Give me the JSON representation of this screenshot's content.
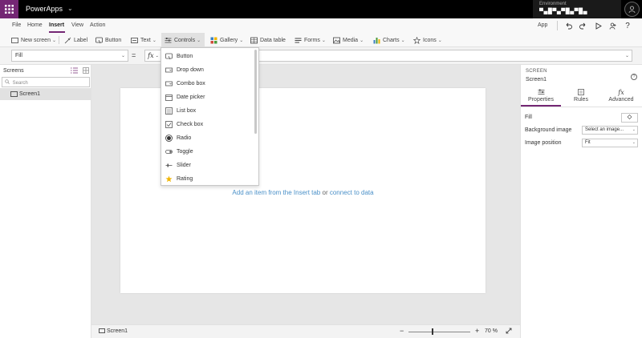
{
  "titlebar": {
    "app_name": "PowerApps",
    "environment_label": "Environment",
    "environment_value": "▀▄█▀▄▀█▄▀█▄"
  },
  "menu": {
    "items": [
      "File",
      "Home",
      "Insert",
      "View",
      "Action"
    ],
    "active": "Insert",
    "app_label": "App"
  },
  "ribbon": {
    "new_screen": "New screen",
    "label": "Label",
    "button": "Button",
    "text": "Text",
    "controls": "Controls",
    "gallery": "Gallery",
    "data_table": "Data table",
    "forms": "Forms",
    "media": "Media",
    "charts": "Charts",
    "icons": "Icons"
  },
  "formula": {
    "property": "Fill",
    "equals": "=",
    "fx": "fx"
  },
  "left_panel": {
    "title": "Screens",
    "search_placeholder": "Search",
    "screens": [
      "Screen1"
    ]
  },
  "canvas": {
    "hint_link1": "Add an item from the Insert tab",
    "hint_or": "or",
    "hint_link2": "connect to data"
  },
  "controls_dropdown": {
    "items": [
      "Button",
      "Drop down",
      "Combo box",
      "Date picker",
      "List box",
      "Check box",
      "Radio",
      "Toggle",
      "Slider",
      "Rating"
    ]
  },
  "right_panel": {
    "type": "SCREEN",
    "name": "Screen1",
    "tabs": [
      "Properties",
      "Rules",
      "Advanced"
    ],
    "fill_label": "Fill",
    "bg_image_label": "Background image",
    "bg_image_value": "Select an image...",
    "image_position_label": "Image position",
    "image_position_value": "Fit"
  },
  "statusbar": {
    "screen": "Screen1",
    "zoom_minus": "−",
    "zoom_plus": "+",
    "zoom_value": "70 %"
  },
  "colors": {
    "accent": "#742774",
    "link": "#4a90c8"
  }
}
